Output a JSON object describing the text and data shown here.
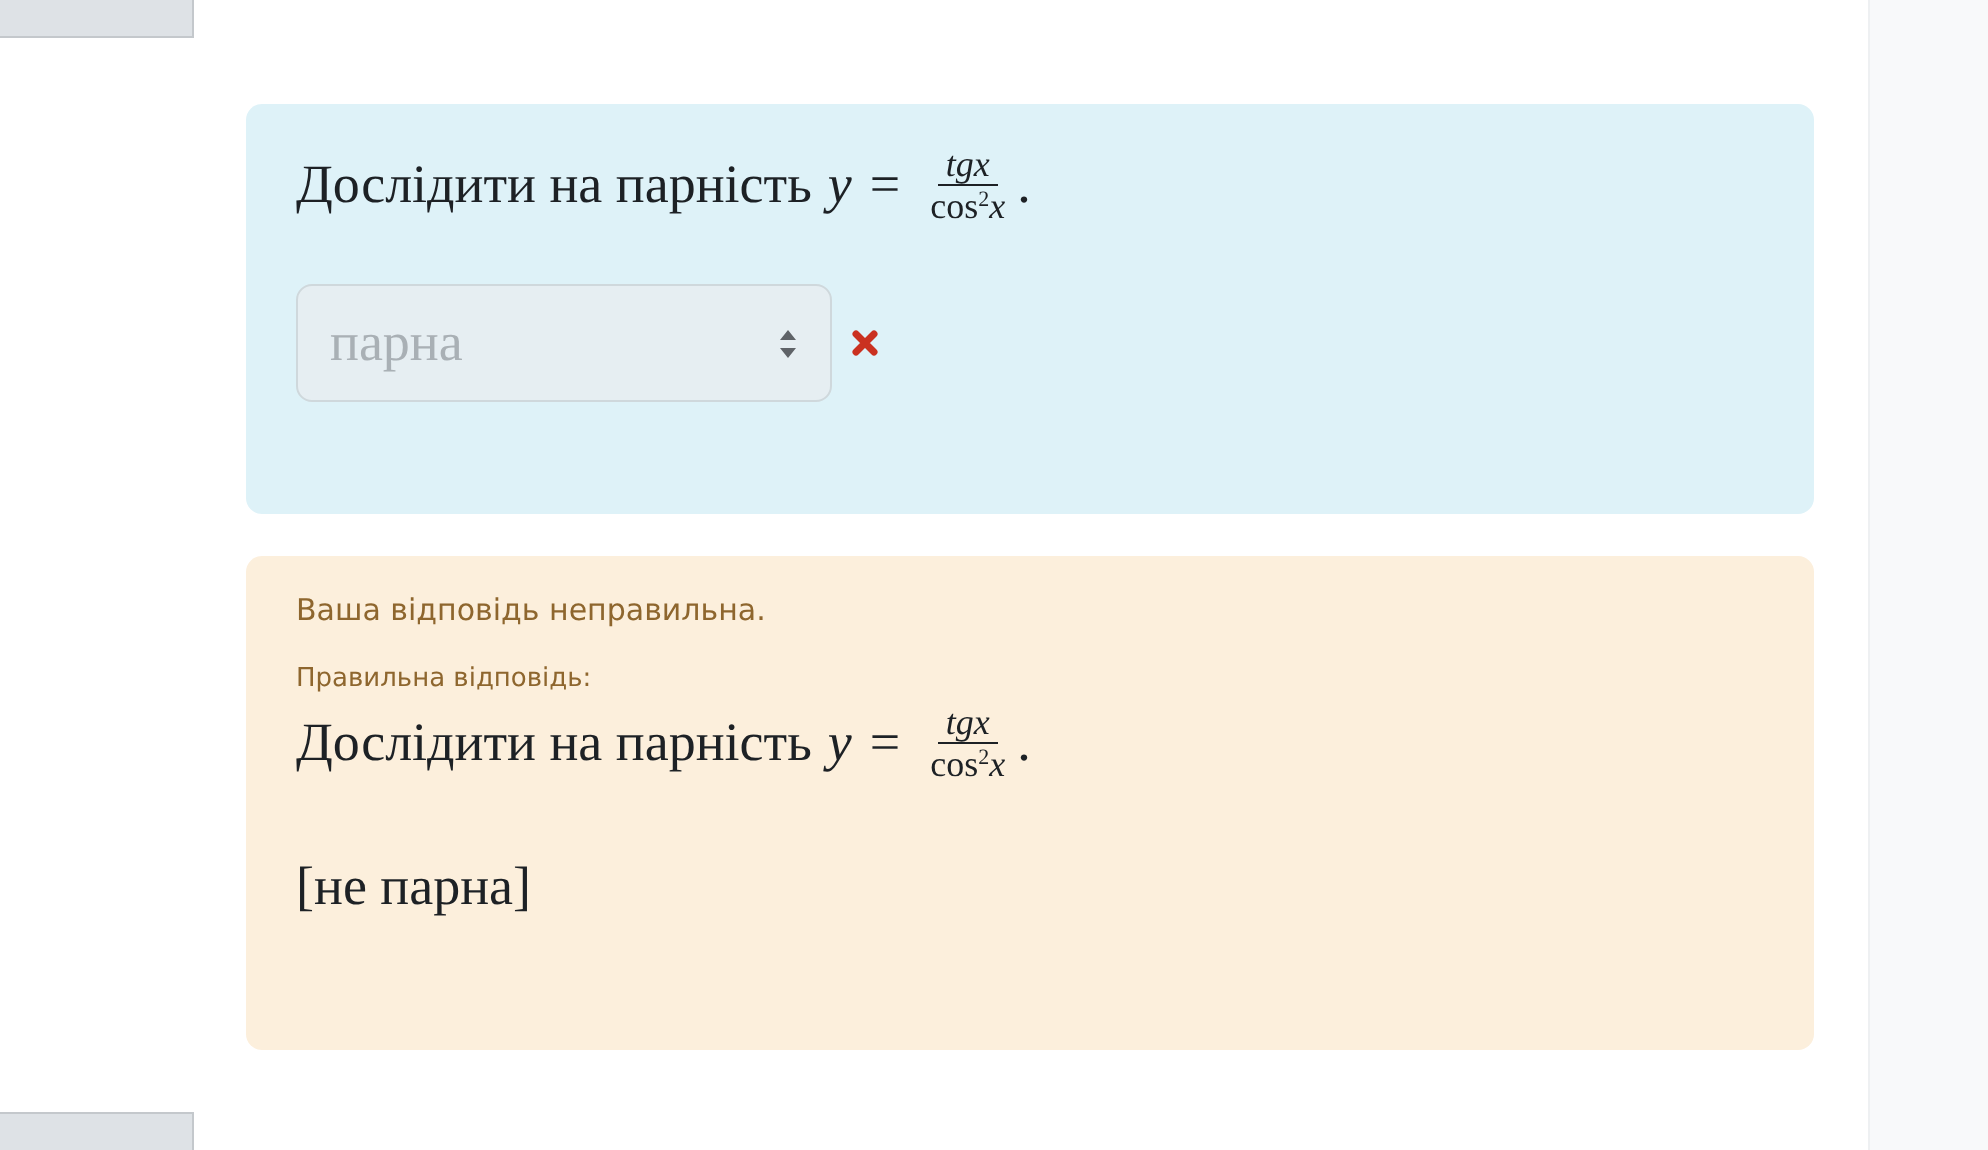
{
  "question": {
    "text": "Дослідити на парність",
    "formula": {
      "lhs": "y",
      "relation": "=",
      "numerator": "tgx",
      "denominator_function": "cos",
      "exponent": "2",
      "denominator_variable": "x"
    },
    "end": "."
  },
  "answer_select": {
    "value": "парна",
    "disabled": true,
    "correct": false
  },
  "feedback": {
    "result": "Ваша відповідь неправильна.",
    "right_answer_label": "Правильна відповідь:",
    "question": {
      "text": "Дослідити на парність",
      "formula": {
        "lhs": "y",
        "relation": "=",
        "numerator": "tgx",
        "denominator_function": "cos",
        "exponent": "2",
        "denominator_variable": "x"
      },
      "end": "."
    },
    "right_answer": "[не парна]"
  }
}
